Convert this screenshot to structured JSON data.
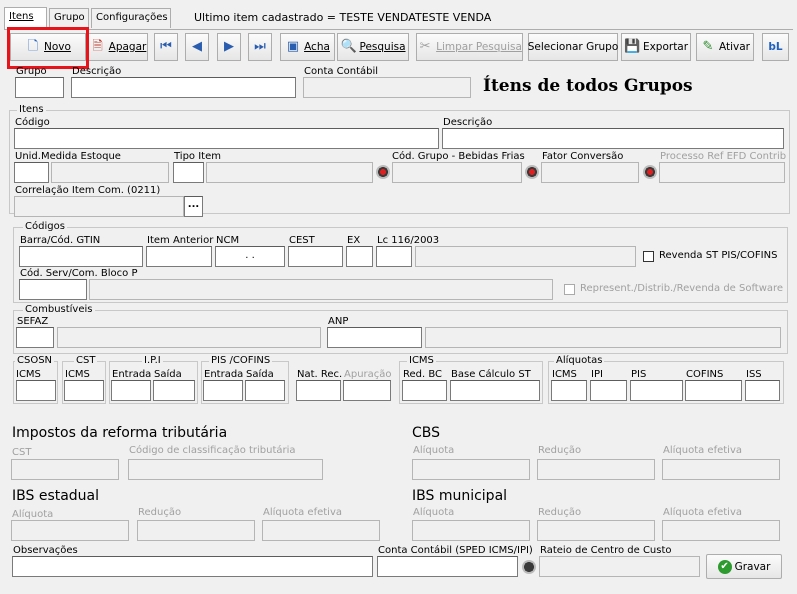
{
  "tabs": [
    "Itens",
    "Grupo",
    "Configurações"
  ],
  "status": "Ultimo item cadastrado = TESTE VENDATESTE VENDA",
  "toolbar": {
    "novo": "Novo",
    "apagar": "Apagar",
    "acha": "Acha",
    "pesquisa": "Pesquisa",
    "limpar": "Limpar Pesquisa",
    "selecionar": "Selecionar Grupo",
    "exportar": "Exportar",
    "ativar": "Ativar"
  },
  "top": {
    "grupo": "Grupo",
    "descricao": "Descrição",
    "conta": "Conta Contábil",
    "title": "Ítens de todos Grupos"
  },
  "itens": {
    "group": "Itens",
    "codigo": "Código",
    "descricao": "Descrição",
    "unid": "Unid.Medida Estoque",
    "tipo": "Tipo Item",
    "cod_grupo": "Cód. Grupo - Bebidas Frias",
    "fator": "Fator Conversão",
    "processo": "Processo Ref EFD Contrib",
    "correlacao": "Correlação Item Com. (0211)",
    "ellipsis": "..."
  },
  "codigos": {
    "group": "Códigos",
    "barra": "Barra/Cód. GTIN",
    "anterior": "Item Anterior",
    "ncm": "NCM",
    "ncm_value": ". .",
    "cest": "CEST",
    "ex": "EX",
    "lc": "Lc 116/2003",
    "revenda": "Revenda ST PIS/COFINS",
    "serv": "Cód. Serv/Com. Bloco P",
    "represent": "Represent./Distrib./Revenda de Software"
  },
  "combustiveis": {
    "group": "Combustíveis",
    "sefaz": "SEFAZ",
    "anp": "ANP"
  },
  "tax": {
    "csosn": "CSOSN",
    "csosn_icms": "ICMS",
    "cst": "CST",
    "cst_icms": "ICMS",
    "ipi": "I.P.I",
    "ipi_entrada": "Entrada",
    "ipi_saida": "Saída",
    "pis": "PIS /COFINS",
    "pis_entrada": "Entrada",
    "pis_saida": "Saída",
    "nat": "Nat. Rec.",
    "apuracao": "Apuração",
    "icms": "ICMS",
    "redbc": "Red. BC",
    "basecalc": "Base Cálculo ST",
    "aliquotas": "Alíquotas",
    "a_icms": "ICMS",
    "a_ipi": "IPI",
    "a_pis": "PIS",
    "a_cofins": "COFINS",
    "a_iss": "ISS"
  },
  "reforma": {
    "title": "Impostos da reforma tributária",
    "cst": "CST",
    "codigo": "Código de classificação tributária",
    "cbs": "CBS",
    "cbs_aliquota": "Alíquota",
    "cbs_reducao": "Redução",
    "cbs_efetiva": "Alíquota efetiva",
    "ibs_est": "IBS estadual",
    "est_aliquota": "Alíquota",
    "est_reducao": "Redução",
    "est_efetiva": "Alíquota efetiva",
    "ibs_mun": "IBS municipal",
    "mun_aliquota": "Alíquota",
    "mun_reducao": "Redução",
    "mun_efetiva": "Alíquota efetiva"
  },
  "bottom": {
    "observacoes": "Observações",
    "conta_sped": "Conta Contábil (SPED ICMS/IPI)",
    "rateio": "Rateio de Centro de Custo",
    "gravar": "Gravar"
  },
  "colors": {
    "highlight": "#e8141b",
    "accent": "#1f5fbf"
  }
}
